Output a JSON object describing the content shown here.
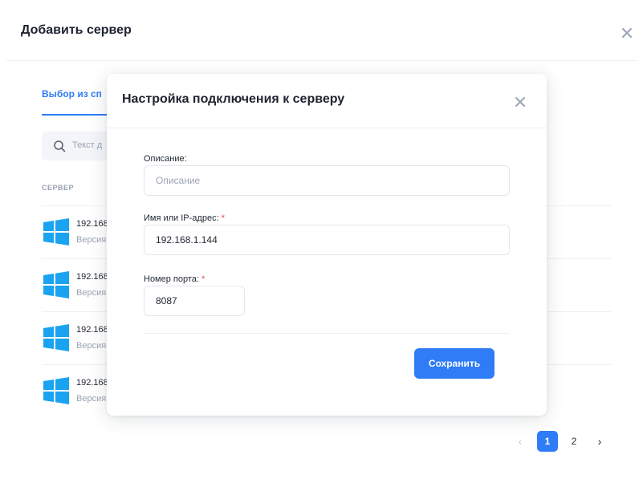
{
  "outer": {
    "title": "Добавить сервер",
    "tab_label": "Выбор из сп",
    "search_placeholder": "Текст д",
    "column_header": "СЕРВЕР",
    "rows": [
      {
        "ip": "192.168",
        "version": "Версия"
      },
      {
        "ip": "192.168",
        "version": "Версия"
      },
      {
        "ip": "192.168",
        "version": "Версия"
      },
      {
        "ip": "192.168",
        "version": "Версия"
      }
    ],
    "pagination": {
      "prev": "‹",
      "pages": [
        "1",
        "2"
      ],
      "current": "1",
      "next": "›"
    }
  },
  "modal": {
    "title": "Настройка подключения к серверу",
    "description_label": "Описание:",
    "description_placeholder": "Описание",
    "description_value": "",
    "host_label": "Имя или IP-адрес:",
    "host_value": "192.168.1.144",
    "port_label": "Номер порта:",
    "port_value": "8087",
    "required_mark": "*",
    "save_label": "Сохранить"
  },
  "colors": {
    "accent": "#2f7cf6",
    "required": "#e5484d",
    "windows_icon": "#1aa3f0"
  },
  "icons": {
    "close": "close-icon",
    "search": "search-icon",
    "os": "windows-icon"
  }
}
